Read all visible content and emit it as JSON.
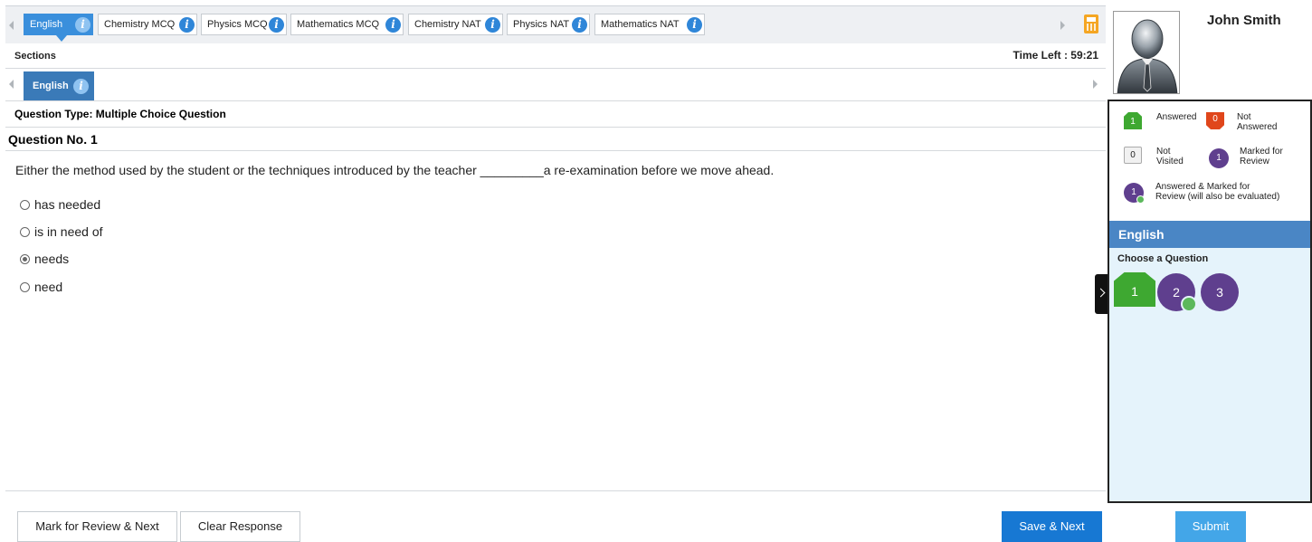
{
  "section_tabs": [
    {
      "label": "English",
      "active": true
    },
    {
      "label": "Chemistry MCQ",
      "active": false
    },
    {
      "label": "Physics MCQ",
      "active": false
    },
    {
      "label": "Mathematics MCQ",
      "active": false
    },
    {
      "label": "Chemistry NAT",
      "active": false
    },
    {
      "label": "Physics NAT",
      "active": false
    },
    {
      "label": "Mathematics NAT",
      "active": false
    }
  ],
  "info_glyph": "i",
  "sections_label": "Sections",
  "time_left": "Time Left : 59:21",
  "sub_tab": {
    "label": "English"
  },
  "question": {
    "type_label": "Question Type: Multiple Choice Question",
    "number_label": "Question No. 1",
    "text": "Either the method used by the student or the techniques introduced by the teacher _________a re-examination before we move ahead.",
    "options": [
      {
        "label": "has needed",
        "selected": false
      },
      {
        "label": "is in need of",
        "selected": false
      },
      {
        "label": "needs",
        "selected": true
      },
      {
        "label": "need",
        "selected": false
      }
    ]
  },
  "actions": {
    "mark_review": "Mark for Review & Next",
    "clear": "Clear Response",
    "save_next": "Save & Next"
  },
  "user": {
    "name": "John Smith"
  },
  "legend": {
    "answered": {
      "count": "1",
      "label": "Answered"
    },
    "not_answered": {
      "count": "0",
      "label": "Not Answered"
    },
    "not_visited": {
      "count": "0",
      "label": "Not Visited"
    },
    "marked": {
      "count": "1",
      "label": "Marked for Review"
    },
    "answered_marked": {
      "count": "1",
      "label": "Answered & Marked for Review (will also be evaluated)"
    }
  },
  "palette": {
    "section": "English",
    "choose_label": "Choose a Question",
    "questions": [
      {
        "number": "1",
        "status": "answered"
      },
      {
        "number": "2",
        "status": "answered-marked"
      },
      {
        "number": "3",
        "status": "marked"
      }
    ]
  },
  "submit_label": "Submit",
  "colors": {
    "active_tab": "#3a8fdc",
    "answered": "#3ea831",
    "not_answered": "#e0461b",
    "marked": "#5f3f8e",
    "save_button": "#1778d3",
    "submit_button": "#43a6e8",
    "section_header": "#4a86c5"
  },
  "icons": [
    "info-icon",
    "calculator-icon",
    "avatar-icon",
    "radio-icon",
    "collapse-arrow-icon"
  ]
}
